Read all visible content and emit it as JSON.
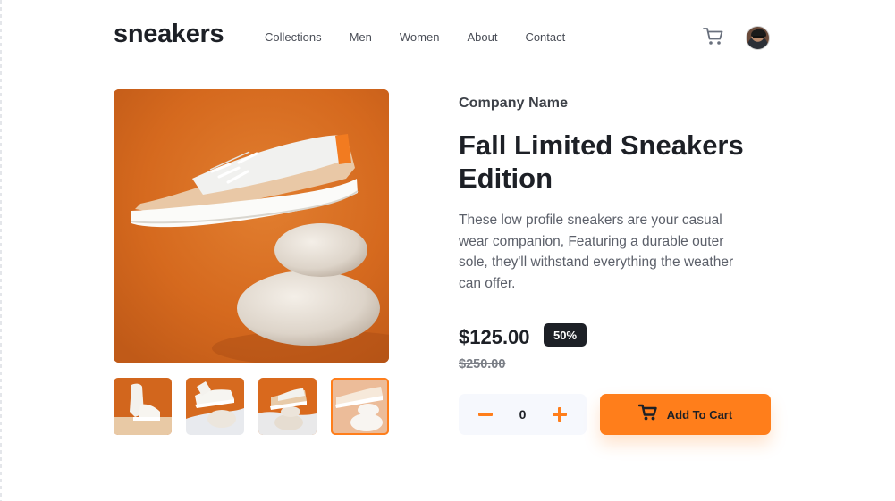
{
  "brand": {
    "logo": "sneakers"
  },
  "nav": {
    "items": [
      "Collections",
      "Men",
      "Women",
      "About",
      "Contact"
    ]
  },
  "header": {
    "cart_icon": "cart-icon",
    "avatar_icon": "avatar"
  },
  "product": {
    "company": "Company Name",
    "title": "Fall Limited Sneakers Edition",
    "description": "These low profile sneakers are your casual wear companion, Featuring a durable outer sole, they'll withstand everything the weather can offer.",
    "price": "$125.00",
    "discount": "50%",
    "original_price": "$250.00"
  },
  "cart": {
    "quantity": "0",
    "add_label": "Add To Cart"
  },
  "colors": {
    "accent": "#ff7e1b",
    "dark": "#1d2026",
    "pale": "#f6f8fd"
  }
}
